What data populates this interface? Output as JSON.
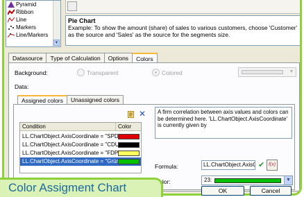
{
  "chart_types": [
    {
      "label": "Pyramid",
      "icon": "pyramid-icon",
      "color": "#7030a0"
    },
    {
      "label": "Ribbon",
      "icon": "ribbon-icon",
      "color": "#c00000"
    },
    {
      "label": "Line",
      "icon": "line-icon",
      "color": "#c00000"
    },
    {
      "label": "Markers",
      "icon": "markers-icon",
      "color": "#404040"
    },
    {
      "label": "Line/Markers",
      "icon": "line-markers-icon",
      "color": "#c00000"
    }
  ],
  "description": {
    "title": "Pie Chart",
    "text": "Example: To show the amount (share) of sales to various customers, choose 'Customer' as the source and 'Sales' as the source for the segments size."
  },
  "tabs": [
    "Datasource",
    "Type of Calculation",
    "Options",
    "Colors"
  ],
  "active_tab": "Colors",
  "background": {
    "label": "Background:",
    "option_transparent": "Transparent",
    "option_colored": "Colored"
  },
  "data_label": "Data:",
  "sub_tabs": [
    "Assigned colors",
    "Unassigned colors"
  ],
  "table": {
    "headers": [
      "Condition",
      "Color"
    ],
    "rows": [
      {
        "condition": "LL.ChartObject.AxisCoordinate = \"SPD\"",
        "color": "#e00000"
      },
      {
        "condition": "LL.ChartObject.AxisCoordinate = \"CDU\"",
        "color": "#000000"
      },
      {
        "condition": "LL.ChartObject.AxisCoordinate = \"FDP\"",
        "color": "#ffff60"
      },
      {
        "condition": "LL.ChartObject.AxisCoordinate = \"Grüne\"",
        "color": "#00c000"
      }
    ]
  },
  "info_text": "A firm correlation between axis values and colors can be determined here. 'LL.ChartObject.AxisCoordinate' is currently given by",
  "formula": {
    "label": "Formula:",
    "value": "LL.ChartObject.AxisCoordinat",
    "button": "f(x)"
  },
  "color": {
    "label": "Color:",
    "number": "23:",
    "value": "#00c000"
  },
  "buttons": {
    "ok": "OK",
    "cancel": "Cancel"
  },
  "caption": "Color Assigment Chart",
  "accent_color": "#8fd13a"
}
